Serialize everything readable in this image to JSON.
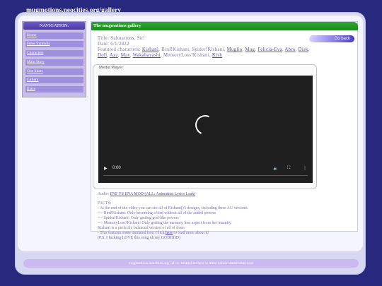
{
  "site_title": "mugmotions.neocities.org/gallery",
  "nav": {
    "header": "NAVIGATION:",
    "links": [
      "Home",
      "Filler Symbols",
      "Characters",
      "Main Story",
      "One Shots",
      "Gallery",
      "Extra"
    ]
  },
  "main": {
    "header": "The mugmotions gallery",
    "go_back": "Go back",
    "title_line": "Title: Salutations, Sir!",
    "date_line": "Date: 6/1/2022",
    "featured_label": "Featured characters:",
    "featured_chars": [
      "Kishani",
      "Bird!Kishani",
      "Spider!Kishani",
      "Muglio",
      "Mug",
      "Felicia-Eva",
      "Abro",
      "Disk",
      "Doll",
      "Azz",
      "May",
      "Wakabayashi",
      "MemoryLoss!Kishani",
      "Kish"
    ]
  },
  "media_player": {
    "title": "Media Player",
    "time": "0:00"
  },
  "audio": {
    "label": "Audio:",
    "link_text": "FNF VS ENA MOD (ALL: Animation Lyrics Leak)"
  },
  "facts": {
    "heading": "FACTS:",
    "lines": [
      "- At the end of the video you can see all of Kishani()'s designs, including three AU versions",
      "--> Bird!Kishani: Only becoming a bird without all of the added powers",
      "--> Spider!Kishani: Only getting god-like powers",
      "--> MemoryLoss!Kishani: Only getting the memory loss aspect from her insanity",
      "Kishani is a perfectly balanced version of all of them"
    ],
    "link_line_prefix": "- This features some outdated lore; Click ",
    "link_word": "here",
    "link_line_suffix": " to read more about it!",
    "closing": "(P.S. I fucking LOVE this song oh my GODDDD)"
  },
  "footer": "mugmotions.neocities.org | all oc related art here is mine unless stated otherwise"
}
